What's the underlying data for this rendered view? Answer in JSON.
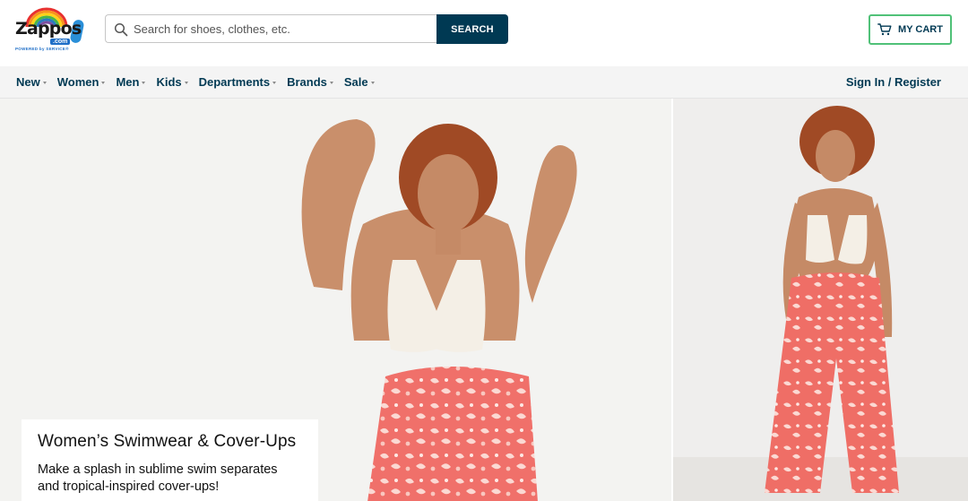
{
  "header": {
    "logo": {
      "wordmark": "Zappos",
      "dotcom": ".com",
      "tagline": "POWERED by SERVICE®"
    },
    "search": {
      "placeholder": "Search for shoes, clothes, etc.",
      "value": "",
      "button_label": "SEARCH"
    },
    "cart": {
      "label": "MY CART",
      "icon": "cart-icon"
    }
  },
  "nav": {
    "items": [
      {
        "label": "New",
        "has_dropdown": true
      },
      {
        "label": "Women",
        "has_dropdown": true
      },
      {
        "label": "Men",
        "has_dropdown": true
      },
      {
        "label": "Kids",
        "has_dropdown": true
      },
      {
        "label": "Departments",
        "has_dropdown": true
      },
      {
        "label": "Brands",
        "has_dropdown": true
      },
      {
        "label": "Sale",
        "has_dropdown": true
      }
    ],
    "account_link": "Sign In / Register"
  },
  "hero": {
    "title": "Women’s Swimwear & Cover-Ups",
    "subtitle": "Make a splash in sublime swim separates and tropical-inspired cover-ups!"
  },
  "colors": {
    "brand_navy": "#003953",
    "cart_border": "#50c178",
    "nav_bg": "#f4f4f4",
    "pants_coral": "#f0706a"
  }
}
